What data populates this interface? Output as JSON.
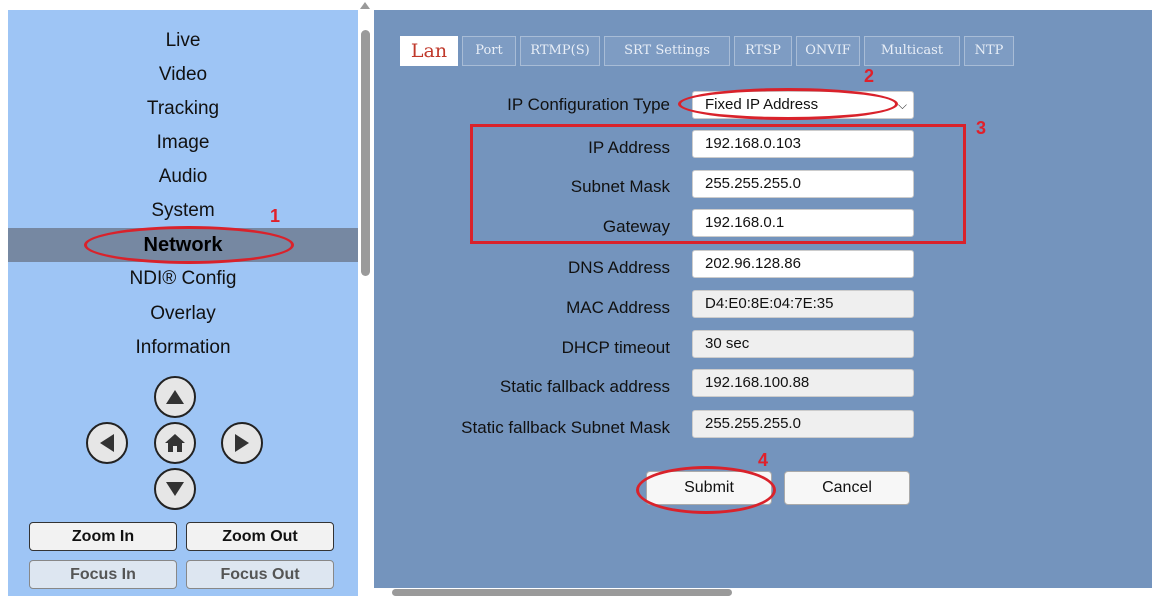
{
  "sidebar": {
    "items": [
      {
        "label": "Live"
      },
      {
        "label": "Video"
      },
      {
        "label": "Tracking"
      },
      {
        "label": "Image"
      },
      {
        "label": "Audio"
      },
      {
        "label": "System"
      },
      {
        "label": "Network",
        "active": true
      },
      {
        "label": "NDI® Config"
      },
      {
        "label": "Overlay"
      },
      {
        "label": "Information"
      }
    ],
    "zoom_in": "Zoom In",
    "zoom_out": "Zoom Out",
    "focus_in": "Focus In",
    "focus_out": "Focus Out"
  },
  "tabs": [
    "Lan",
    "Port",
    "RTMP(S)",
    "SRT Settings",
    "RTSP",
    "ONVIF",
    "Multicast",
    "NTP"
  ],
  "form": {
    "ip_type_label": "IP Configuration Type",
    "ip_type_value": "Fixed IP Address",
    "ip_address_label": "IP Address",
    "ip_address_value": "192.168.0.103",
    "subnet_label": "Subnet Mask",
    "subnet_value": "255.255.255.0",
    "gateway_label": "Gateway",
    "gateway_value": "192.168.0.1",
    "dns_label": "DNS Address",
    "dns_value": "202.96.128.86",
    "mac_label": "MAC Address",
    "mac_value": "D4:E0:8E:04:7E:35",
    "dhcp_label": "DHCP timeout",
    "dhcp_value": "30 sec",
    "fallback_addr_label": "Static fallback address",
    "fallback_addr_value": "192.168.100.88",
    "fallback_mask_label": "Static fallback Subnet Mask",
    "fallback_mask_value": "255.255.255.0",
    "submit": "Submit",
    "cancel": "Cancel"
  },
  "annotations": [
    "1",
    "2",
    "3",
    "4"
  ],
  "colors": {
    "sidebar_bg": "#9ec5f5",
    "main_bg": "#7494bd",
    "active_item_bg": "#7688a2",
    "annotation_red": "#d9222b"
  }
}
